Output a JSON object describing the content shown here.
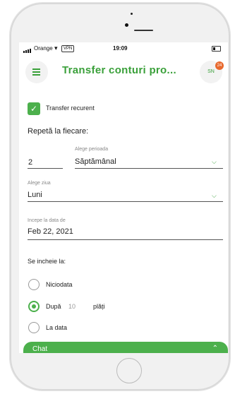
{
  "status_bar": {
    "carrier": "Orange",
    "vpn": "VPN",
    "time": "19:09"
  },
  "header": {
    "title": "Transfer conturi pro...",
    "avatar_initials": "SN",
    "notification_count": "24"
  },
  "recurrent": {
    "label": "Transfer recurent",
    "checked": true
  },
  "repeat": {
    "heading": "Repetă la fiecare:",
    "count_value": "2",
    "period_label": "Alege perioada",
    "period_value": "Săptămânal",
    "day_label": "Alege ziua",
    "day_value": "Luni"
  },
  "start": {
    "label": "Incepe la data de",
    "value": "Feb 22, 2021"
  },
  "end": {
    "heading": "Se incheie la:",
    "options": [
      {
        "label": "Niciodata",
        "selected": false
      },
      {
        "label": "După",
        "value": "10",
        "suffix": "plăți",
        "selected": true
      },
      {
        "label": "La data",
        "selected": false
      }
    ]
  },
  "chat": {
    "label": "Chat"
  },
  "colors": {
    "accent": "#4cb04c",
    "badge": "#e8692e"
  },
  "icons": [
    "signal-icon",
    "wifi-icon",
    "battery-icon",
    "menu-icon",
    "check-icon",
    "chevron-down-icon",
    "chevron-up-icon"
  ]
}
